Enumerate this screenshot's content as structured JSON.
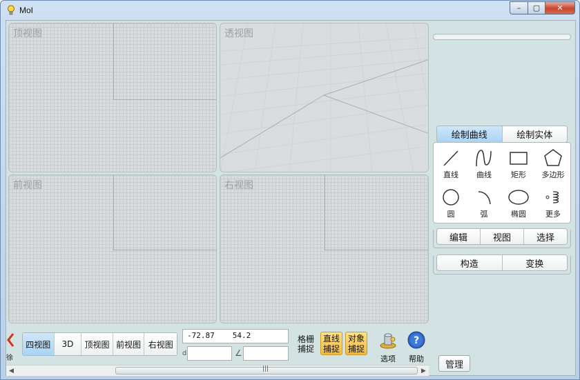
{
  "window": {
    "title": "MoI",
    "controls": {
      "minimize": "–",
      "maximize": "▢",
      "close": "✕"
    }
  },
  "viewports": [
    {
      "id": "top",
      "label": "顶视图"
    },
    {
      "id": "persp",
      "label": "透视图"
    },
    {
      "id": "front",
      "label": "前视图"
    },
    {
      "id": "right",
      "label": "右视图"
    }
  ],
  "draw_tabs": {
    "curves": "绘制曲线",
    "solids": "绘制实体",
    "active": "curves"
  },
  "tools": [
    {
      "name": "line",
      "label": "直线",
      "icon": "line-icon"
    },
    {
      "name": "curve",
      "label": "曲线",
      "icon": "curve-icon"
    },
    {
      "name": "rectangle",
      "label": "矩形",
      "icon": "rectangle-icon"
    },
    {
      "name": "polygon",
      "label": "多边形",
      "icon": "polygon-icon"
    },
    {
      "name": "circle",
      "label": "圆",
      "icon": "circle-icon"
    },
    {
      "name": "arc",
      "label": "弧",
      "icon": "arc-icon"
    },
    {
      "name": "ellipse",
      "label": "椭圆",
      "icon": "ellipse-icon"
    },
    {
      "name": "more",
      "label": "更多",
      "icon": "helix-icon"
    }
  ],
  "tab_row2": [
    "编辑",
    "视图",
    "选择"
  ],
  "tab_row3": [
    "构造",
    "变换"
  ],
  "viewbar": {
    "back_label": "徐",
    "buttons": [
      "四视图",
      "3D",
      "顶视图",
      "前视图",
      "右视图"
    ],
    "active": "四视图"
  },
  "coords": {
    "x": "-72.87",
    "y": "54.2",
    "distance": "",
    "angle": "",
    "distance_glyph": "d",
    "angle_glyph": "∠"
  },
  "snaps": {
    "grid": "格栅捕捉",
    "grid_line1": "格栅",
    "grid_line2": "捕捉",
    "line_line1": "直线",
    "line_line2": "捕捉",
    "object_line1": "对象",
    "object_line2": "捕捉"
  },
  "options_label": "选项",
  "help_label": "帮助",
  "manage_label": "管理",
  "scroll_grip": "|||",
  "colors": {
    "accent": "#a9d4f5",
    "snap_active": "#f3b93a",
    "client_bg": "#d3e3e3"
  }
}
